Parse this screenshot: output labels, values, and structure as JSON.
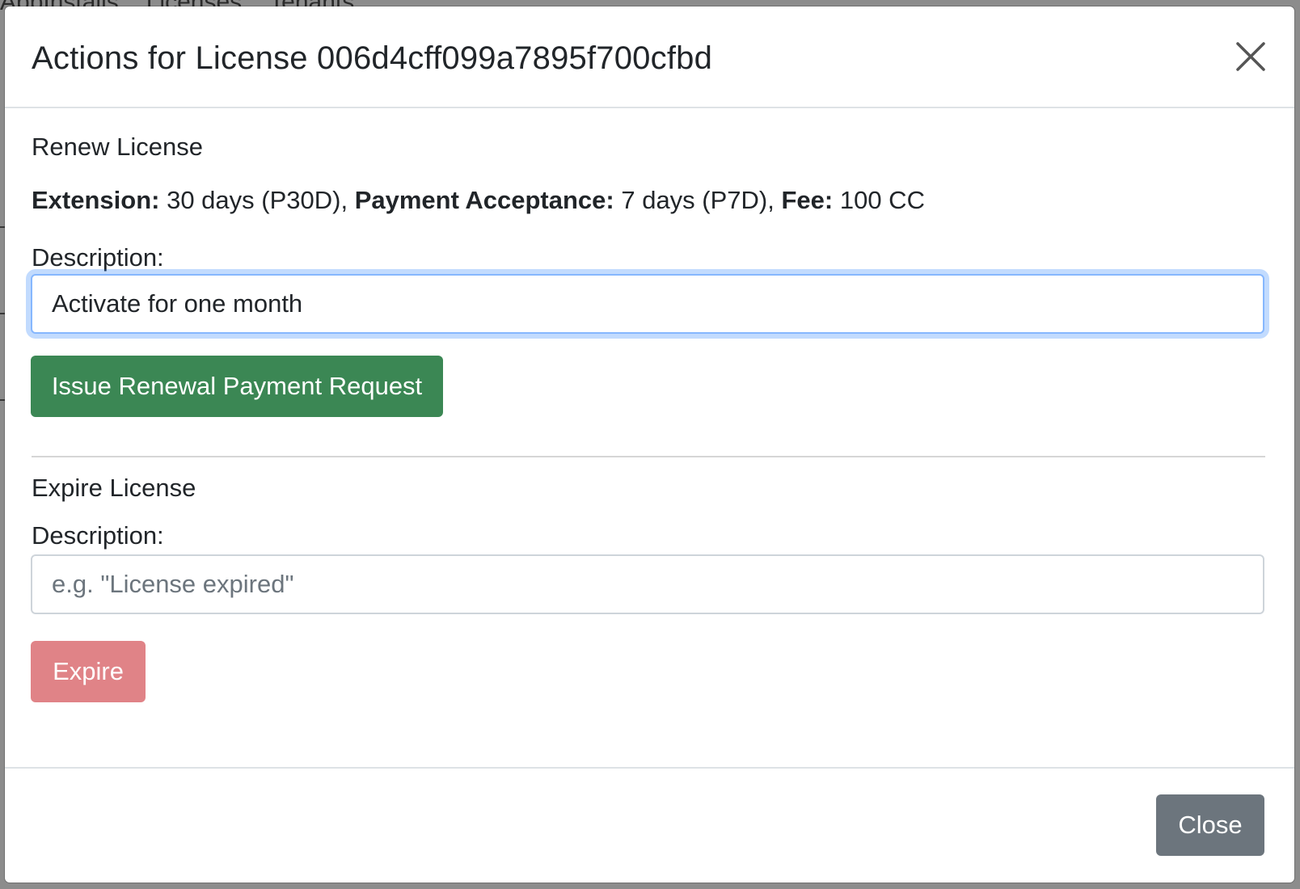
{
  "background": {
    "nav_items": [
      "AppInstalls",
      "Licenses",
      "Tenants"
    ]
  },
  "modal": {
    "title": "Actions for License 006d4cff099a7895f700cfbd",
    "close_icon": "close-icon"
  },
  "renew": {
    "heading": "Renew License",
    "extension_label": "Extension:",
    "extension_value": " 30 days (P30D), ",
    "payment_label": "Payment Acceptance:",
    "payment_value": " 7 days (P7D), ",
    "fee_label": "Fee:",
    "fee_value": " 100 CC",
    "description_label": "Description:",
    "description_value": "Activate for one month",
    "button_label": "Issue Renewal Payment Request"
  },
  "expire": {
    "heading": "Expire License",
    "description_label": "Description:",
    "description_placeholder": "e.g. \"License expired\"",
    "button_label": "Expire"
  },
  "footer": {
    "close_label": "Close"
  },
  "colors": {
    "renew_button": "#3b8754",
    "expire_button": "#e08387",
    "close_button": "#6c757d",
    "focus_ring": "#86b7fe"
  }
}
